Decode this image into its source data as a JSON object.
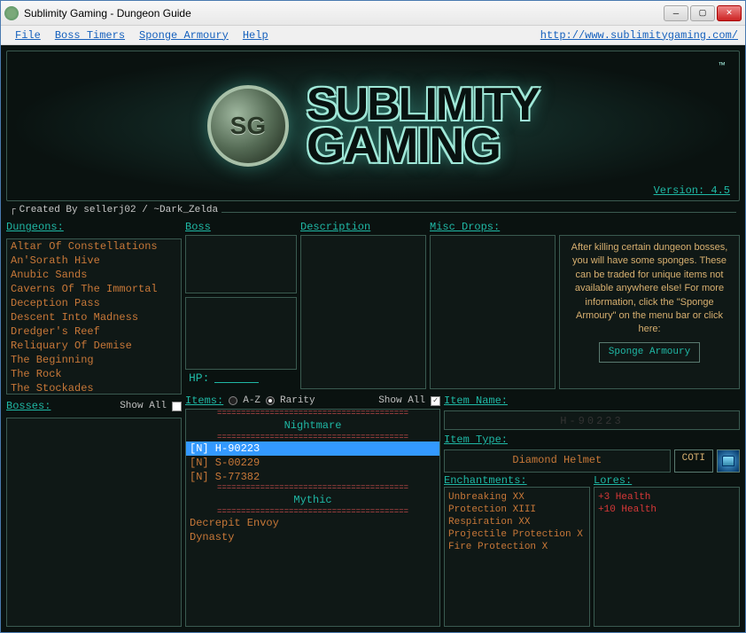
{
  "window": {
    "title": "Sublimity Gaming - Dungeon Guide"
  },
  "menu": {
    "file": "File",
    "boss_timers": "Boss Timers",
    "sponge_armoury": "Sponge Armoury",
    "help": "Help",
    "url": "http://www.sublimitygaming.com/"
  },
  "banner": {
    "line1": "SUBLIMITY",
    "line2": "GAMING",
    "trademark": "™",
    "version_label": "Version: 4.5"
  },
  "created_by": "Created By sellerj02 / ~Dark_Zelda",
  "labels": {
    "dungeons": "Dungeons:",
    "boss": "Boss",
    "description": "Description",
    "misc_drops": "Misc Drops:",
    "bosses": "Bosses:",
    "show_all": "Show All",
    "items": "Items:",
    "sort_az": "A-Z",
    "sort_rarity": "Rarity",
    "item_name": "Item Name:",
    "item_type": "Item Type:",
    "enchantments": "Enchantments:",
    "lores": "Lores:",
    "hp": "HP:",
    "coti": "COTI"
  },
  "info": {
    "text": "After killing certain dungeon bosses, you will have some sponges. These can be traded for unique items not available anywhere else! For more information, click the \"Sponge Armoury\" on the menu bar or click here:",
    "button": "Sponge Armoury"
  },
  "dungeons": [
    "Altar Of Constellations",
    "An'Sorath Hive",
    "Anubic Sands",
    "Caverns Of The Immortal",
    "Deception Pass",
    "Descent Into Madness",
    "Dredger's Reef",
    "Reliquary Of Demise",
    "The Beginning",
    "The Rock",
    "The Stockades"
  ],
  "items": {
    "rarity_headers": {
      "nightmare": "Nightmare",
      "mythic": "Mythic"
    },
    "nightmare": [
      "[N] H-90223",
      "[N] S-00229",
      "[N] S-77382"
    ],
    "mythic": [
      "Decrepit Envoy",
      "Dynasty"
    ],
    "selected": "[N] H-90223"
  },
  "item_detail": {
    "name_hidden": "H-90223",
    "type": "Diamond Helmet",
    "enchantments": [
      "Unbreaking XX",
      "Protection XIII",
      "Respiration XX",
      "Projectile Protection X",
      "Fire Protection X"
    ],
    "lores": [
      "+3 Health",
      "+10 Health"
    ]
  },
  "controls": {
    "bosses_show_all_checked": false,
    "items_show_all_checked": true,
    "sort_az_checked": false,
    "sort_rarity_checked": true
  }
}
